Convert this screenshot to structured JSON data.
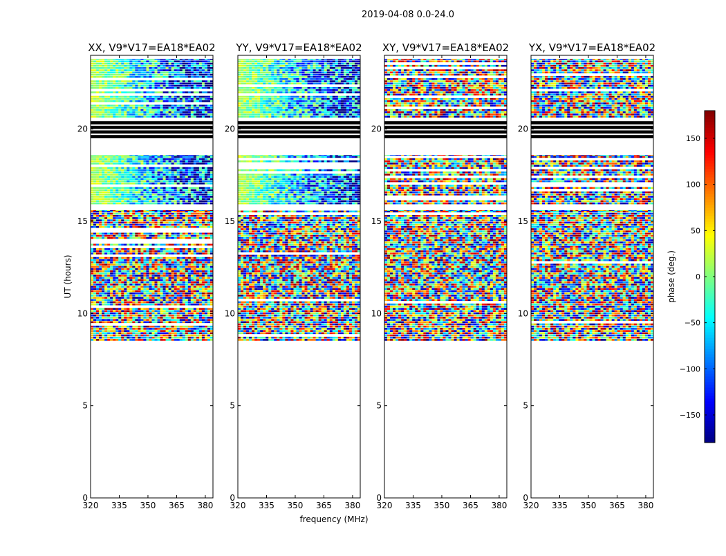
{
  "figure": {
    "suptitle": "2019-04-08 0.0-24.0"
  },
  "chart_data": {
    "type": "heatmap",
    "description_free": true,
    "xlabel": "frequency (MHz)",
    "ylabel": "UT (hours)",
    "xlim": [
      320,
      384
    ],
    "ylim": [
      0,
      24
    ],
    "xticks": [
      320,
      335,
      350,
      365,
      380
    ],
    "yticks": [
      0,
      5,
      10,
      15,
      20
    ],
    "panels": [
      {
        "title": "XX, V9*V17=EA18*EA02",
        "pattern": "coherent-pos"
      },
      {
        "title": "YY, V9*V17=EA18*EA02",
        "pattern": "coherent-pos"
      },
      {
        "title": "XY, V9*V17=EA18*EA02",
        "pattern": "noise"
      },
      {
        "title": "YX, V9*V17=EA18*EA02",
        "pattern": "noise"
      }
    ],
    "data_time_ranges_hours": [
      [
        8.5,
        15.6
      ],
      [
        15.9,
        18.6
      ],
      [
        20.6,
        23.8
      ]
    ],
    "flagged_band_hours": [
      19.5,
      20.5
    ],
    "colorbar": {
      "label": "phase (deg.)",
      "range": [
        -180,
        180
      ],
      "ticks": [
        150,
        100,
        50,
        0,
        -50,
        -100,
        -150
      ],
      "colormap": "jet",
      "colors": [
        "#00007f",
        "#0000ff",
        "#007fff",
        "#00ffff",
        "#7fff7f",
        "#ffff00",
        "#ff7f00",
        "#ff0000",
        "#7f0000"
      ]
    }
  }
}
